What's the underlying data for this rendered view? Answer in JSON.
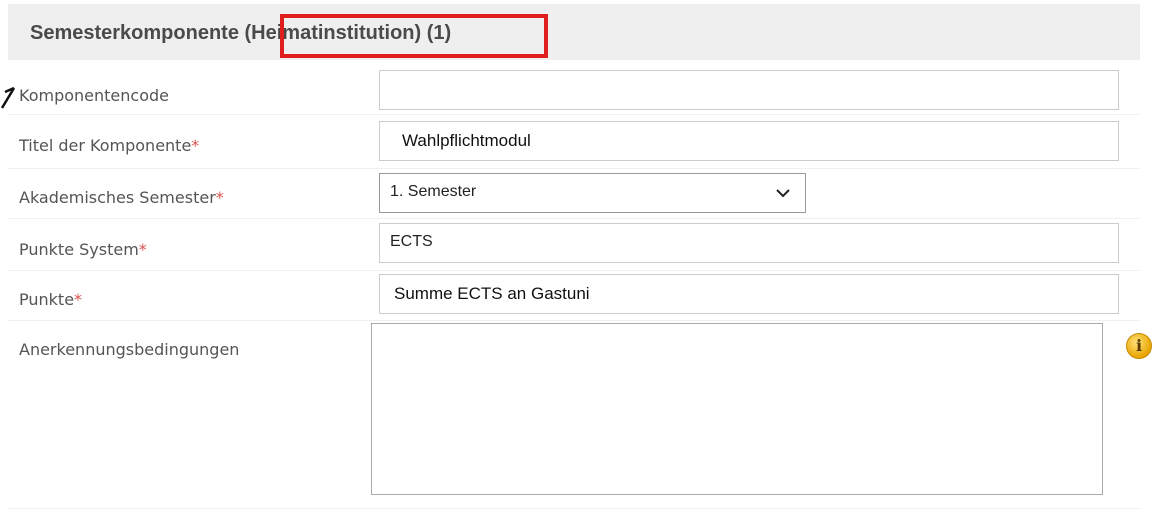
{
  "section": {
    "title": "Semesterkomponente (Heimatinstitution) (1)"
  },
  "fields": {
    "komponentencode": {
      "label": "Komponentencode",
      "value": ""
    },
    "titel": {
      "label": "Titel der Komponente",
      "required": "*",
      "value": "Wahlpflichtmodul"
    },
    "semester": {
      "label": "Akademisches Semester",
      "required": "*",
      "value": "1. Semester"
    },
    "punkte_system": {
      "label": "Punkte System",
      "required": "*",
      "value": "ECTS"
    },
    "punkte": {
      "label": "Punkte",
      "required": "*",
      "value": "Summe ECTS an Gastuni"
    },
    "anerkennung": {
      "label": "Anerkennungsbedingungen",
      "value": ""
    }
  },
  "icons": {
    "info": "info-icon",
    "dropdown": "chevron-down-icon"
  },
  "colors": {
    "highlight": "#e01e1e",
    "required": "#d9534f",
    "info": "#e8a500"
  }
}
